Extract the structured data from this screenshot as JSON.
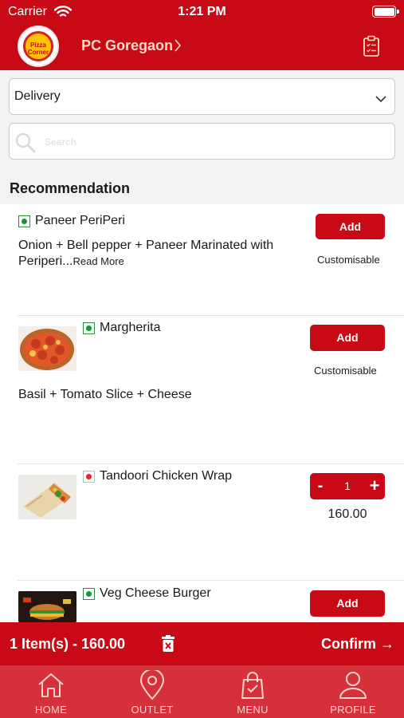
{
  "status_bar": {
    "carrier": "Carrier",
    "time": "1:21 PM"
  },
  "header": {
    "outlet_name": "PC Goregaon",
    "logo_text": "Pizza Corner"
  },
  "order_type": {
    "selected": "Delivery"
  },
  "search": {
    "placeholder": "Search"
  },
  "section_title": "Recommendation",
  "items": [
    {
      "name": "Paneer PeriPeri",
      "type": "veg",
      "desc": "Onion + Bell pepper + Paneer Marinated with Periperi...",
      "read_more": "Read More",
      "action": "Add",
      "note": "Customisable"
    },
    {
      "name": "Margherita",
      "type": "veg",
      "desc": "Basil + Tomato Slice + Cheese",
      "action": "Add",
      "note": "Customisable"
    },
    {
      "name": "Tandoori Chicken Wrap",
      "type": "non-veg",
      "qty": "1",
      "minus": "-",
      "plus": "+",
      "price": "160.00"
    },
    {
      "name": "Veg Cheese Burger",
      "type": "veg",
      "action": "Add"
    }
  ],
  "cart": {
    "summary": "1 Item(s) - 160.00",
    "confirm": "Confirm →"
  },
  "tabs": [
    {
      "label": "HOME",
      "icon": "home-icon"
    },
    {
      "label": "OUTLET",
      "icon": "location-pin-icon"
    },
    {
      "label": "MENU",
      "icon": "shopping-bag-icon"
    },
    {
      "label": "PROFILE",
      "icon": "user-icon"
    }
  ],
  "colors": {
    "brand_red": "#c70a16",
    "tab_red": "#d6313a",
    "veg_green": "#0f9b34",
    "nonveg_red": "#e4262e"
  }
}
